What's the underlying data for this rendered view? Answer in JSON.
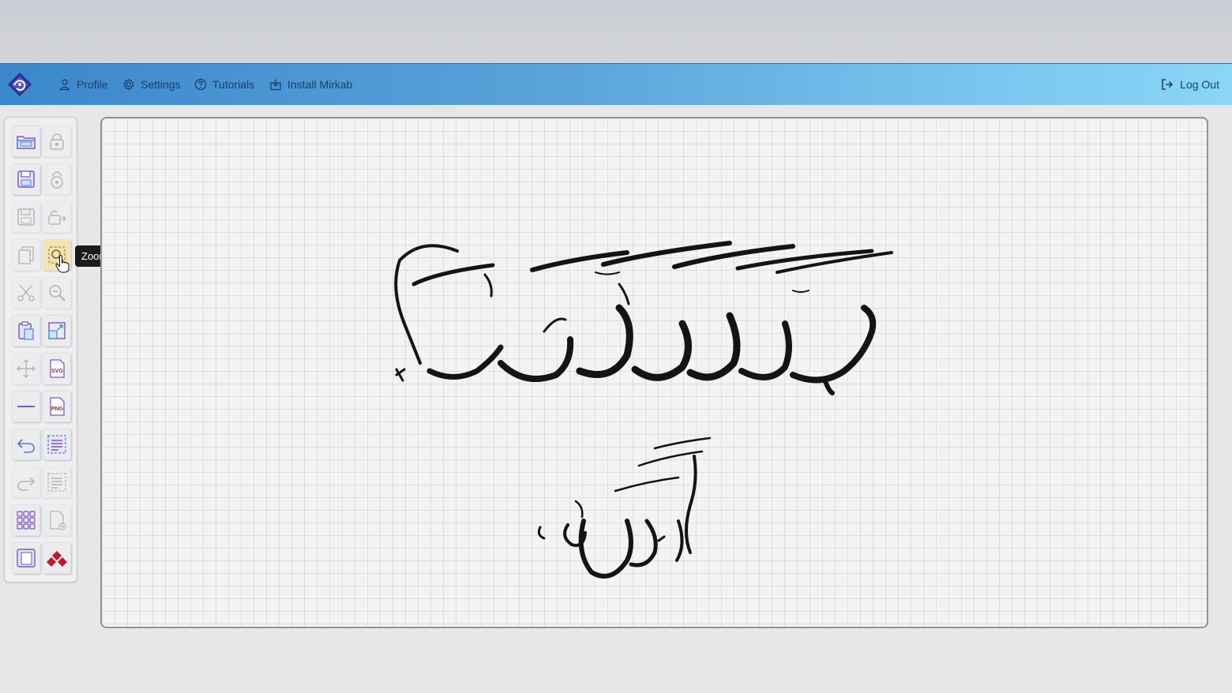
{
  "nav": {
    "profile": "Profile",
    "settings": "Settings",
    "tutorials": "Tutorials",
    "install": "Install Mirkab",
    "logout": "Log Out"
  },
  "tooltip": "Zoom Selected Area",
  "colors": {
    "nav_start": "#3a87cb",
    "nav_end": "#8ad6f6",
    "icon_purple": "#7b57c7",
    "icon_blue": "#4a86d8",
    "brand_red": "#c0182a"
  },
  "toolbar": {
    "left_column": [
      "open-folder-icon",
      "save-icon",
      "save-as-icon",
      "copy-icon",
      "cut-icon",
      "paste-icon",
      "move-icon",
      "line-icon",
      "undo-icon",
      "redo-icon",
      "grid-icon",
      "frame-icon"
    ],
    "right_column": [
      "lock-icon",
      "lock-alt-icon",
      "unlock-icon",
      "zoom-area-icon",
      "zoom-out-icon",
      "resize-icon",
      "svg-export-icon",
      "png-export-icon",
      "text-block-icon",
      "text-block-alt-icon",
      "new-page-icon",
      "logo-stamp-icon"
    ],
    "svg_label": "SVG",
    "png_label": "PNG"
  }
}
